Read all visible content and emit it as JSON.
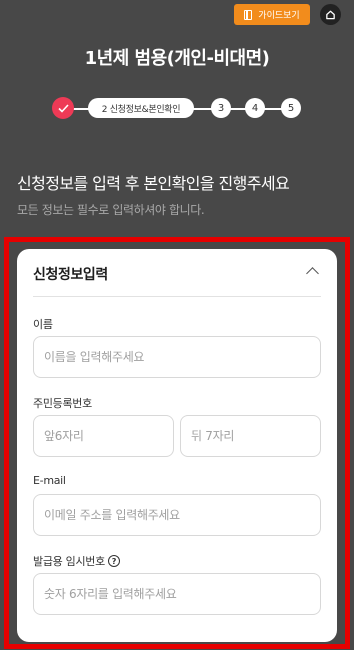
{
  "header": {
    "guide_button_label": "가이드보기",
    "guide_icon": "book-icon",
    "home_icon": "home-icon"
  },
  "page_title": "1년제 범용(개인-비대면)",
  "stepper": {
    "current_label": "2 신청정보&본인확인",
    "steps": [
      "3",
      "4",
      "5"
    ]
  },
  "headline": "신청정보를 입력 후 본인확인을 진행주세요",
  "subline": "모든 정보는 필수로 입력하셔야 합니다.",
  "form": {
    "section_title": "신청정보입력",
    "name_label": "이름",
    "name_placeholder": "이름을 입력해주세요",
    "rrn_label": "주민등록번호",
    "rrn_front_placeholder": "앞6자리",
    "rrn_back_placeholder": "뒤 7자리",
    "email_label": "E-mail",
    "email_placeholder": "이메일 주소를 입력해주세요",
    "temp_label": "발급용 임시번호",
    "temp_placeholder": "숫자 6자리를 입력해주세요"
  },
  "colors": {
    "background": "#484848",
    "accent_orange": "#f28c1c",
    "step_done": "#ee3a56",
    "highlight_frame": "#e60000"
  }
}
